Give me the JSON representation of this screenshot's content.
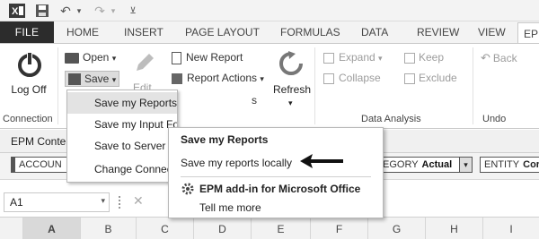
{
  "ribbon_tabs": {
    "file": "FILE",
    "home": "HOME",
    "insert": "INSERT",
    "page_layout": "PAGE LAYOUT",
    "formulas": "FORMULAS",
    "data": "DATA",
    "review": "REVIEW",
    "view": "VIEW",
    "epm": "EP"
  },
  "ribbon": {
    "log_off": "Log Off",
    "open": "Open",
    "save": "Save",
    "edit": "Edit",
    "new_report": "New Report",
    "report_actions": "Report Actions",
    "refresh": "Refresh",
    "expand": "Expand",
    "collapse": "Collapse",
    "keep": "Keep",
    "exclude": "Exclude",
    "back": "Back",
    "groups": {
      "connection": "Connection",
      "data_analysis": "Data Analysis",
      "undo": "Undo"
    }
  },
  "context_bar": {
    "label": "EPM Conte",
    "account": "ACCOUN",
    "category_label": "EGORY",
    "category_value": "Actual",
    "entity_label": "ENTITY",
    "entity_value": "Corpora"
  },
  "formula_bar": {
    "cell_ref": "A1"
  },
  "columns": [
    "A",
    "B",
    "C",
    "D",
    "E",
    "F",
    "G",
    "H",
    "I"
  ],
  "save_menu": {
    "items": [
      "Save my Reports...",
      "Save my Input Forms...",
      "Save to Server R",
      "Change Connec"
    ]
  },
  "submenu": {
    "title": "Save my Reports",
    "save_locally": "Save my reports locally",
    "addin": "EPM add-in for Microsoft Office",
    "tell_me_more": "Tell me more"
  }
}
